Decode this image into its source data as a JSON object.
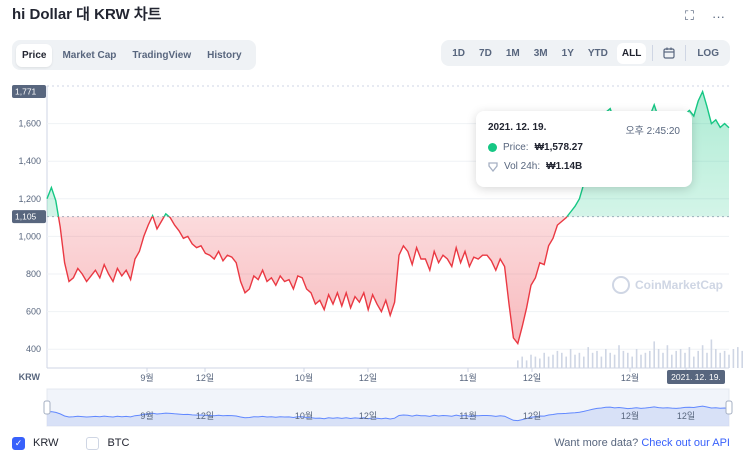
{
  "header": {
    "title": "hi Dollar 대 KRW 차트",
    "fullscreen_icon": "fullscreen-icon",
    "more_icon": "more-icon"
  },
  "tabs": [
    {
      "label": "Price",
      "active": true
    },
    {
      "label": "Market Cap",
      "active": false
    },
    {
      "label": "TradingView",
      "active": false
    },
    {
      "label": "History",
      "active": false
    }
  ],
  "ranges": [
    {
      "label": "1D",
      "active": false
    },
    {
      "label": "7D",
      "active": false
    },
    {
      "label": "1M",
      "active": false
    },
    {
      "label": "3M",
      "active": false
    },
    {
      "label": "1Y",
      "active": false
    },
    {
      "label": "YTD",
      "active": false
    },
    {
      "label": "ALL",
      "active": true
    }
  ],
  "log_label": "LOG",
  "tooltip": {
    "date": "2021. 12. 19.",
    "time": "오후 2:45:20",
    "price_label": "Price:",
    "price_value": "₩1,578.27",
    "vol_label": "Vol 24h:",
    "vol_value": "₩1.14B"
  },
  "watermark": "CoinMarketCap",
  "bottom": {
    "krw_label": "KRW",
    "btc_label": "BTC",
    "more_text": "Want more data?",
    "api_link": "Check out our API"
  },
  "colors": {
    "up": "#16c784",
    "down": "#ea3943",
    "accent": "#3861fb"
  },
  "chart_data": {
    "type": "line",
    "y_ticks": [
      400,
      600,
      800,
      1000,
      1200,
      1400,
      1600
    ],
    "ylim": [
      300,
      1800
    ],
    "current_label": "1,771",
    "baseline_label": "1,105",
    "baseline": 1105,
    "x_axis_title": "KRW",
    "x_ticks": [
      "9월",
      "12일",
      "10월",
      "12일",
      "11월",
      "12일",
      "12월",
      "12일"
    ],
    "crosshair_label": "2021. 12. 19.",
    "brush_ticks": [
      "9월",
      "12일",
      "10월",
      "12일",
      "11월",
      "12일",
      "12월",
      "12일"
    ],
    "series": [
      {
        "values": [
          1200,
          1260,
          1190,
          1050,
          860,
          760,
          780,
          830,
          800,
          760,
          790,
          820,
          780,
          850,
          800,
          760,
          830,
          790,
          820,
          770,
          880,
          920,
          1000,
          1060,
          1110,
          1040,
          1080,
          1120,
          1100,
          1060,
          1030,
          990,
          1000,
          960,
          940,
          950,
          910,
          900,
          880,
          920,
          870,
          900,
          890,
          860,
          760,
          700,
          720,
          790,
          770,
          820,
          760,
          780,
          740,
          790,
          760,
          770,
          720,
          790,
          780,
          720,
          700,
          640,
          660,
          610,
          690,
          640,
          700,
          630,
          700,
          620,
          680,
          650,
          700,
          610,
          690,
          640,
          600,
          660,
          580,
          650,
          900,
          950,
          920,
          850,
          940,
          880,
          880,
          820,
          920,
          860,
          900,
          880,
          840,
          940,
          860,
          920,
          840,
          890,
          880,
          900,
          900,
          870,
          820,
          880,
          840,
          640,
          460,
          430,
          520,
          620,
          740,
          780,
          860,
          850,
          950,
          990,
          1060,
          1080,
          1100,
          1130,
          1160,
          1200,
          1280,
          1380,
          1480,
          1560,
          1600,
          1660,
          1680,
          1610,
          1640,
          1600,
          1540,
          1580,
          1620,
          1560,
          1600,
          1640,
          1700,
          1630,
          1600,
          1620,
          1590,
          1560,
          1600,
          1650,
          1670,
          1640,
          1720,
          1770,
          1690,
          1600,
          1620,
          1580,
          1600,
          1578
        ]
      }
    ],
    "volume": [
      0,
      0,
      0,
      0,
      0,
      0,
      0,
      0,
      0,
      0,
      0,
      0,
      0,
      0,
      0,
      0,
      0,
      0,
      0,
      0,
      0,
      0,
      0,
      0,
      0,
      0,
      0,
      0,
      0,
      0,
      0,
      0,
      0,
      0,
      0,
      0,
      0,
      0,
      0,
      0,
      0,
      0,
      0,
      0,
      0,
      0,
      0,
      0,
      0,
      0,
      0,
      0,
      0,
      0,
      0,
      0,
      0,
      0,
      0,
      0,
      0,
      0,
      0,
      0,
      0,
      0,
      0,
      0,
      0,
      0,
      0,
      0,
      0,
      0,
      0,
      0,
      0,
      0,
      0,
      0,
      0,
      0,
      0,
      0,
      0,
      0,
      0,
      0,
      0,
      0,
      0,
      0,
      0,
      0,
      0,
      0,
      0,
      0,
      0,
      0,
      0,
      0,
      0,
      0,
      0,
      0,
      0,
      0.2,
      0.3,
      0.2,
      0.35,
      0.3,
      0.25,
      0.4,
      0.3,
      0.35,
      0.45,
      0.4,
      0.3,
      0.5,
      0.35,
      0.4,
      0.3,
      0.55,
      0.4,
      0.45,
      0.3,
      0.5,
      0.4,
      0.35,
      0.6,
      0.45,
      0.4,
      0.3,
      0.5,
      0.35,
      0.4,
      0.45,
      0.7,
      0.5,
      0.4,
      0.6,
      0.35,
      0.45,
      0.5,
      0.4,
      0.55,
      0.3,
      0.45,
      0.6,
      0.4,
      0.75,
      0.5,
      0.4,
      0.45,
      0.35,
      0.5,
      0.55,
      0.45,
      0.6,
      0.4
    ]
  }
}
